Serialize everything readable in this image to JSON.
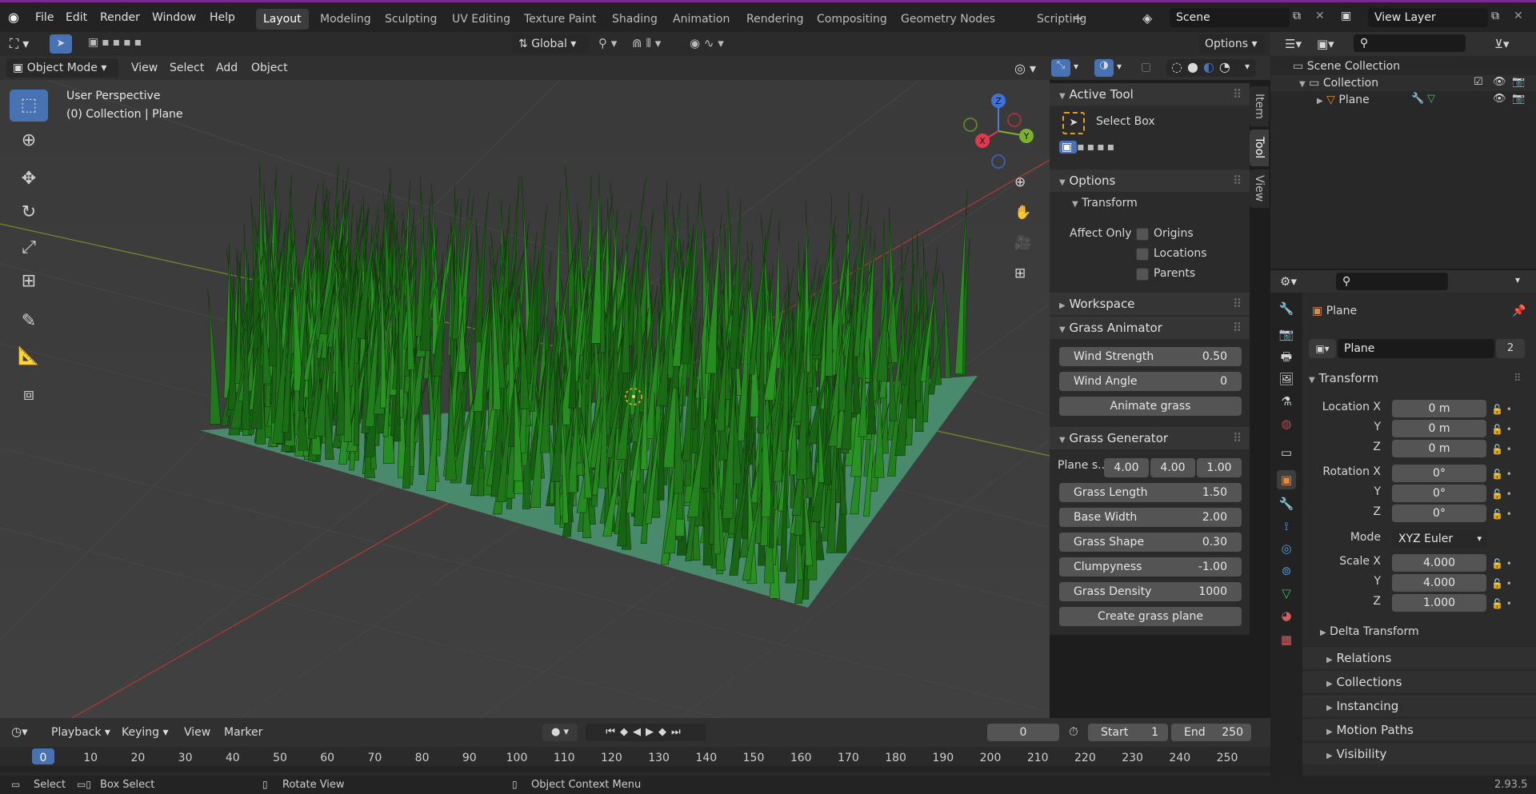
{
  "app": {
    "menus": [
      "File",
      "Edit",
      "Render",
      "Window",
      "Help"
    ],
    "workspaces": [
      "Layout",
      "Modeling",
      "Sculpting",
      "UV Editing",
      "Texture Paint",
      "Shading",
      "Animation",
      "Rendering",
      "Compositing",
      "Geometry Nodes",
      "Scripting"
    ],
    "active_workspace": "Layout",
    "scene_name": "Scene",
    "view_layer": "View Layer"
  },
  "viewport_header": {
    "orientation": "Global",
    "options_label": "Options",
    "mode": "Object Mode",
    "menus": [
      "View",
      "Select",
      "Add",
      "Object"
    ]
  },
  "viewport": {
    "perspective_label": "User Perspective",
    "collection_label": "(0) Collection | Plane",
    "gizmo": {
      "z": "Z",
      "y": "Y",
      "x": "X"
    }
  },
  "npanel": {
    "tabs": [
      "Item",
      "Tool",
      "View"
    ],
    "active_tool_title": "Active Tool",
    "active_tool_name": "Select Box",
    "options_title": "Options",
    "transform_title": "Transform",
    "affect_only": "Affect Only",
    "affect_items": [
      "Origins",
      "Locations",
      "Parents"
    ],
    "workspace_title": "Workspace",
    "grass_animator": {
      "title": "Grass Animator",
      "wind_strength_label": "Wind Strength",
      "wind_strength": "0.50",
      "wind_angle_label": "Wind Angle",
      "wind_angle": "0",
      "animate_button": "Animate grass"
    },
    "grass_generator": {
      "title": "Grass Generator",
      "plane_size_label": "Plane s...",
      "plane_size": [
        "4.00",
        "4.00",
        "1.00"
      ],
      "rows": [
        {
          "label": "Grass Length",
          "value": "1.50"
        },
        {
          "label": "Base Width",
          "value": "2.00"
        },
        {
          "label": "Grass Shape",
          "value": "0.30"
        },
        {
          "label": "Clumpyness",
          "value": "-1.00"
        },
        {
          "label": "Grass Density",
          "value": "1000"
        }
      ],
      "create_button": "Create grass plane"
    }
  },
  "outliner": {
    "scene_collection": "Scene Collection",
    "collection": "Collection",
    "object": "Plane"
  },
  "properties": {
    "object_name": "Plane",
    "data_name": "Plane",
    "users": "2",
    "transform_title": "Transform",
    "location_label": "Location X",
    "location": [
      "0 m",
      "0 m",
      "0 m"
    ],
    "rotation_label": "Rotation X",
    "rotation": [
      "0°",
      "0°",
      "0°"
    ],
    "mode_label": "Mode",
    "mode": "XYZ Euler",
    "scale_label": "Scale X",
    "scale": [
      "4.000",
      "4.000",
      "1.000"
    ],
    "axis_y": "Y",
    "axis_z": "Z",
    "delta": "Delta Transform",
    "sections": [
      "Relations",
      "Collections",
      "Instancing",
      "Motion Paths",
      "Visibility"
    ]
  },
  "timeline": {
    "menus": [
      "Playback",
      "Keying",
      "View",
      "Marker"
    ],
    "current_frame": "0",
    "start_label": "Start",
    "start": "1",
    "end_label": "End",
    "end": "250",
    "ticks": [
      "0",
      "10",
      "20",
      "30",
      "40",
      "50",
      "60",
      "70",
      "80",
      "90",
      "100",
      "110",
      "120",
      "130",
      "140",
      "150",
      "160",
      "170",
      "180",
      "190",
      "200",
      "210",
      "220",
      "230",
      "240",
      "250"
    ]
  },
  "statusbar": {
    "select": "Select",
    "box_select": "Box Select",
    "rotate": "Rotate View",
    "context": "Object Context Menu",
    "version": "2.93.5"
  },
  "colors": {
    "accent": "#4772b3",
    "header_purple": "#7a2b8f",
    "grass": "#2f6a2a",
    "plane": "#4a8a6c"
  }
}
